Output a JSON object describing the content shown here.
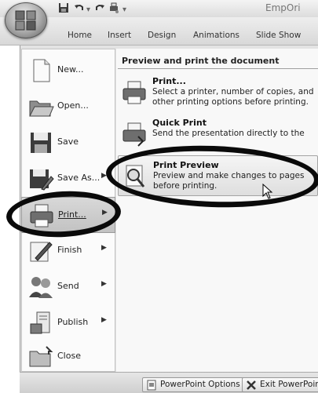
{
  "window": {
    "title": "EmpOri"
  },
  "ribbon": {
    "tabs": [
      "Home",
      "Insert",
      "Design",
      "Animations",
      "Slide Show"
    ]
  },
  "menu": {
    "items": [
      {
        "label": "New...",
        "icon": "new-document-icon",
        "arrow": false
      },
      {
        "label": "Open...",
        "icon": "folder-open-icon",
        "arrow": false
      },
      {
        "label": "Save",
        "icon": "save-disk-icon",
        "arrow": false
      },
      {
        "label": "Save As...",
        "icon": "save-as-icon",
        "arrow": true
      },
      {
        "label": "Print...",
        "icon": "printer-icon",
        "arrow": true,
        "selected": true
      },
      {
        "label": "Finish",
        "icon": "finish-pen-icon",
        "arrow": true
      },
      {
        "label": "Send",
        "icon": "send-people-icon",
        "arrow": true
      },
      {
        "label": "Publish",
        "icon": "publish-server-icon",
        "arrow": true
      },
      {
        "label": "Close",
        "icon": "close-folder-icon",
        "arrow": false
      }
    ]
  },
  "submenu": {
    "header": "Preview and print the document",
    "items": [
      {
        "title": "Print...",
        "description": "Select a printer, number of copies, and other printing options before printing.",
        "icon": "printer-icon"
      },
      {
        "title": "Quick Print",
        "description": "Send the presentation directly to the",
        "icon": "quick-print-icon"
      },
      {
        "title": "Print Preview",
        "description": "Preview and make changes to pages before printing.",
        "icon": "print-preview-icon",
        "highlighted": true
      }
    ]
  },
  "footer": {
    "options_label": "PowerPoint Options",
    "exit_label": "Exit PowerPoint"
  }
}
